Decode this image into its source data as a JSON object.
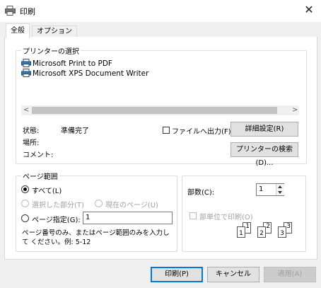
{
  "window": {
    "title": "印刷",
    "close_symbol": "✕"
  },
  "tabs": [
    {
      "label": "全般",
      "active": true
    },
    {
      "label": "オプション",
      "active": false
    }
  ],
  "printer_select": {
    "legend": "プリンターの選択",
    "printers": [
      "Microsoft Print to PDF",
      "Microsoft XPS Document Writer"
    ],
    "scroll_left": "<",
    "scroll_right": ">"
  },
  "status": {
    "state_label": "状態:",
    "state_value": "準備完了",
    "location_label": "場所:",
    "location_value": "",
    "comment_label": "コメント:",
    "comment_value": ""
  },
  "print_to_file": {
    "label": "ファイルへ出力(F)",
    "checked": false
  },
  "buttons": {
    "preferences": "詳細設定(R)",
    "find_printer": "プリンターの検索(D)...",
    "print": "印刷(P)",
    "cancel": "キャンセル",
    "apply": "適用(A)"
  },
  "page_range": {
    "legend": "ページ範囲",
    "all": "すべて(L)",
    "selection": "選択した部分(T)",
    "current": "現在のページ(U)",
    "pages": "ページ指定(G):",
    "pages_value": "1",
    "hint": "ページ番号のみ、またはページ範囲のみを入力して ください。例: 5-12"
  },
  "copies": {
    "label": "部数(C):",
    "value": "1",
    "collate": "部単位で印刷(O)",
    "collate_checked": false,
    "collate_pages": [
      "1",
      "1",
      "2",
      "2",
      "3",
      "3"
    ]
  },
  "colors": {
    "accent": "#0078d7",
    "disabled_text": "#a0a0a0",
    "panel": "#ffffff",
    "window": "#f0f0f0"
  },
  "icons": {
    "title": "printer-icon",
    "printer": "printer-icon",
    "close": "close-icon"
  }
}
